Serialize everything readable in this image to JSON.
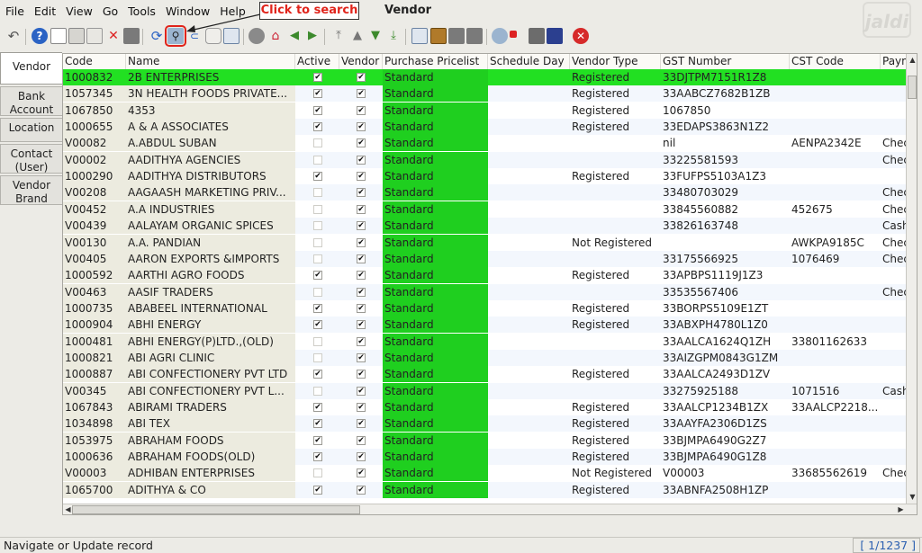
{
  "menu": [
    "File",
    "Edit",
    "View",
    "Go",
    "Tools",
    "Window",
    "Help"
  ],
  "window_title": "Vendor",
  "callout": "Click to search",
  "logo_text": "jaldi",
  "tabs": [
    "Vendor",
    "Bank Account",
    "Location",
    "Contact (User)",
    "Vendor Brand"
  ],
  "columns": [
    "Code",
    "Name",
    "Active",
    "Vendor",
    "Purchase Pricelist",
    "Schedule Day",
    "Vendor Type",
    "GST Number",
    "CST Code",
    "Paym"
  ],
  "rows": [
    {
      "code": "1000832",
      "name": "2B ENTERPRISES",
      "active": true,
      "vendor": true,
      "pricelist": "Standard",
      "schedule": "",
      "type": "Registered",
      "gst": "33DJTPM7151R1Z8",
      "cst": "",
      "pay": "",
      "selected": true
    },
    {
      "code": "1057345",
      "name": "3N HEALTH FOODS PRIVATE...",
      "active": true,
      "vendor": true,
      "pricelist": "Standard",
      "schedule": "",
      "type": "Registered",
      "gst": "33AABCZ7682B1ZB",
      "cst": "",
      "pay": ""
    },
    {
      "code": "1067850",
      "name": "4353",
      "active": true,
      "vendor": true,
      "pricelist": "Standard",
      "schedule": "",
      "type": "Registered",
      "gst": "1067850",
      "cst": "",
      "pay": ""
    },
    {
      "code": "1000655",
      "name": "A & A ASSOCIATES",
      "active": true,
      "vendor": true,
      "pricelist": "Standard",
      "schedule": "",
      "type": "Registered",
      "gst": "33EDAPS3863N1Z2",
      "cst": "",
      "pay": ""
    },
    {
      "code": "V00082",
      "name": "A.ABDUL SUBAN",
      "active": false,
      "vendor": true,
      "pricelist": "Standard",
      "schedule": "",
      "type": "",
      "gst": "nil",
      "cst": "AENPA2342E",
      "pay": "Chec"
    },
    {
      "code": "V00002",
      "name": "AADITHYA AGENCIES",
      "active": false,
      "vendor": true,
      "pricelist": "Standard",
      "schedule": "",
      "type": "",
      "gst": "33225581593",
      "cst": "",
      "pay": "Chec"
    },
    {
      "code": "1000290",
      "name": "AADITHYA DISTRIBUTORS",
      "active": true,
      "vendor": true,
      "pricelist": "Standard",
      "schedule": "",
      "type": "Registered",
      "gst": "33FUFPS5103A1Z3",
      "cst": "",
      "pay": ""
    },
    {
      "code": "V00208",
      "name": "AAGAASH MARKETING PRIV...",
      "active": false,
      "vendor": true,
      "pricelist": "Standard",
      "schedule": "",
      "type": "",
      "gst": "33480703029",
      "cst": "",
      "pay": "Chec"
    },
    {
      "code": "V00452",
      "name": "A.A INDUSTRIES",
      "active": false,
      "vendor": true,
      "pricelist": "Standard",
      "schedule": "",
      "type": "",
      "gst": "33845560882",
      "cst": "452675",
      "pay": "Chec"
    },
    {
      "code": "V00439",
      "name": "AALAYAM ORGANIC SPICES",
      "active": false,
      "vendor": true,
      "pricelist": "Standard",
      "schedule": "",
      "type": "",
      "gst": "33826163748",
      "cst": "",
      "pay": "Cash"
    },
    {
      "code": "V00130",
      "name": "A.A. PANDIAN",
      "active": false,
      "vendor": true,
      "pricelist": "Standard",
      "schedule": "",
      "type": "Not Registered",
      "gst": "",
      "cst": "AWKPA9185C",
      "pay": "Chec"
    },
    {
      "code": "V00405",
      "name": "AARON EXPORTS &IMPORTS",
      "active": false,
      "vendor": true,
      "pricelist": "Standard",
      "schedule": "",
      "type": "",
      "gst": "33175566925",
      "cst": "1076469",
      "pay": "Chec"
    },
    {
      "code": "1000592",
      "name": "AARTHI AGRO FOODS",
      "active": true,
      "vendor": true,
      "pricelist": "Standard",
      "schedule": "",
      "type": "Registered",
      "gst": "33APBPS1119J1Z3",
      "cst": "",
      "pay": ""
    },
    {
      "code": "V00463",
      "name": "AASIF TRADERS",
      "active": false,
      "vendor": true,
      "pricelist": "Standard",
      "schedule": "",
      "type": "",
      "gst": "33535567406",
      "cst": "",
      "pay": "Chec"
    },
    {
      "code": "1000735",
      "name": "ABABEEL INTERNATIONAL",
      "active": true,
      "vendor": true,
      "pricelist": "Standard",
      "schedule": "",
      "type": "Registered",
      "gst": "33BORPS5109E1ZT",
      "cst": "",
      "pay": ""
    },
    {
      "code": "1000904",
      "name": "ABHI ENERGY",
      "active": true,
      "vendor": true,
      "pricelist": "Standard",
      "schedule": "",
      "type": "Registered",
      "gst": "33ABXPH4780L1Z0",
      "cst": "",
      "pay": ""
    },
    {
      "code": "1000481",
      "name": "ABHI ENERGY(P)LTD.,(OLD)",
      "active": false,
      "vendor": true,
      "pricelist": "Standard",
      "schedule": "",
      "type": "",
      "gst": "33AALCA1624Q1ZH",
      "cst": "33801162633",
      "pay": ""
    },
    {
      "code": "1000821",
      "name": "ABI AGRI CLINIC",
      "active": false,
      "vendor": true,
      "pricelist": "Standard",
      "schedule": "",
      "type": "",
      "gst": "33AIZGPM0843G1ZM",
      "cst": "",
      "pay": ""
    },
    {
      "code": "1000887",
      "name": "ABI CONFECTIONERY PVT LTD",
      "active": true,
      "vendor": true,
      "pricelist": "Standard",
      "schedule": "",
      "type": "Registered",
      "gst": "33AALCA2493D1ZV",
      "cst": "",
      "pay": ""
    },
    {
      "code": "V00345",
      "name": "ABI CONFECTIONERY PVT L...",
      "active": false,
      "vendor": true,
      "pricelist": "Standard",
      "schedule": "",
      "type": "",
      "gst": "33275925188",
      "cst": "1071516",
      "pay": "Cash"
    },
    {
      "code": "1067843",
      "name": "ABIRAMI TRADERS",
      "active": true,
      "vendor": true,
      "pricelist": "Standard",
      "schedule": "",
      "type": "Registered",
      "gst": "33AALCP1234B1ZX",
      "cst": "33AALCP2218...",
      "pay": ""
    },
    {
      "code": "1034898",
      "name": "ABI TEX",
      "active": true,
      "vendor": true,
      "pricelist": "Standard",
      "schedule": "",
      "type": "Registered",
      "gst": "33AAYFA2306D1ZS",
      "cst": "",
      "pay": ""
    },
    {
      "code": "1053975",
      "name": "ABRAHAM FOODS",
      "active": true,
      "vendor": true,
      "pricelist": "Standard",
      "schedule": "",
      "type": "Registered",
      "gst": "33BJMPA6490G2Z7",
      "cst": "",
      "pay": ""
    },
    {
      "code": "1000636",
      "name": "ABRAHAM FOODS(OLD)",
      "active": true,
      "vendor": true,
      "pricelist": "Standard",
      "schedule": "",
      "type": "Registered",
      "gst": "33BJMPA6490G1Z8",
      "cst": "",
      "pay": ""
    },
    {
      "code": "V00003",
      "name": "ADHIBAN ENTERPRISES",
      "active": false,
      "vendor": true,
      "pricelist": "Standard",
      "schedule": "",
      "type": "Not Registered",
      "gst": "V00003",
      "cst": "33685562619",
      "pay": "Chec"
    },
    {
      "code": "1065700",
      "name": "ADITHYA & CO",
      "active": true,
      "vendor": true,
      "pricelist": "Standard",
      "schedule": "",
      "type": "Registered",
      "gst": "33ABNFA2508H1ZP",
      "cst": "",
      "pay": ""
    }
  ],
  "status_text": "Navigate or Update record",
  "record_count": "[ 1/1237 ]"
}
